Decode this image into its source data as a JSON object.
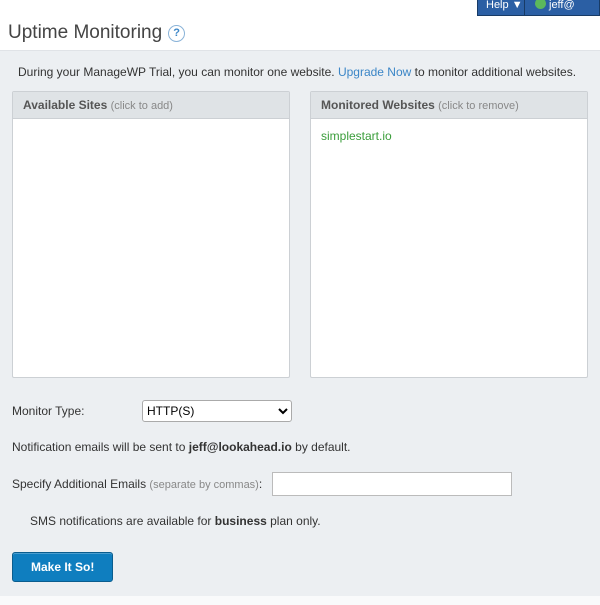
{
  "topbar": {
    "help_label": "Help",
    "user_label": "jeff@"
  },
  "page": {
    "title": "Uptime Monitoring"
  },
  "intro": {
    "prefix": "During your ManageWP Trial, you can monitor one website. ",
    "upgrade_link": "Upgrade Now",
    "suffix": " to monitor additional websites."
  },
  "panels": {
    "available": {
      "title": "Available Sites",
      "hint": "(click to add)",
      "items": []
    },
    "monitored": {
      "title": "Monitored Websites",
      "hint": "(click to remove)",
      "items": [
        "simplestart.io"
      ]
    }
  },
  "monitor_type": {
    "label": "Monitor Type:",
    "selected": "HTTP(S)",
    "options": [
      "HTTP(S)"
    ]
  },
  "email_note": {
    "prefix": "Notification emails will be sent to ",
    "email": "jeff@lookahead.io",
    "suffix": " by default."
  },
  "additional_emails": {
    "label": "Specify Additional Emails",
    "hint": "(separate by commas)",
    "value": ""
  },
  "sms_note": {
    "prefix": "SMS notifications are available for ",
    "bold": "business",
    "suffix": " plan only."
  },
  "submit_label": "Make It So!"
}
